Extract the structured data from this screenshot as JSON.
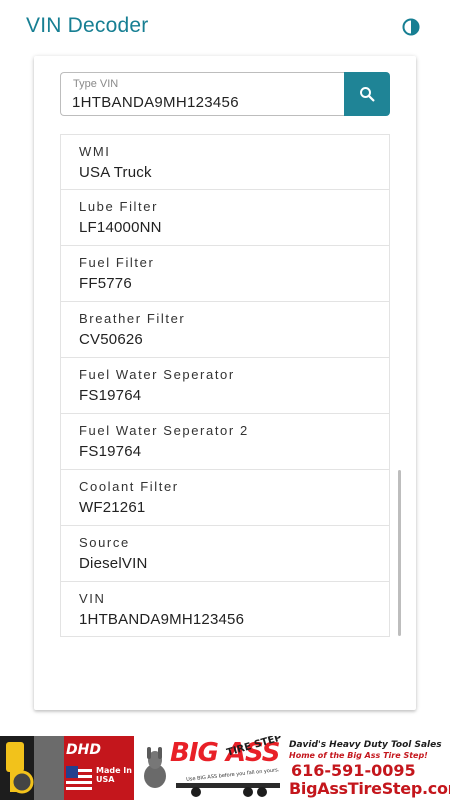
{
  "app": {
    "title": "VIN Decoder",
    "accent_color": "#177f93",
    "theme_toggle_icon": "contrast-icon"
  },
  "search": {
    "label": "Type VIN",
    "value": "1HTBANDA9MH123456",
    "button_icon": "search-icon",
    "button_color": "#1f8496"
  },
  "results": [
    {
      "label": "WMI",
      "value": "USA Truck"
    },
    {
      "label": "Lube Filter",
      "value": "LF14000NN"
    },
    {
      "label": "Fuel Filter",
      "value": "FF5776"
    },
    {
      "label": "Breather Filter",
      "value": "CV50626"
    },
    {
      "label": "Fuel Water Seperator",
      "value": "FS19764"
    },
    {
      "label": "Fuel Water Seperator 2",
      "value": "FS19764"
    },
    {
      "label": "Coolant Filter",
      "value": "WF21261"
    },
    {
      "label": "Source",
      "value": "DieselVIN"
    },
    {
      "label": "VIN",
      "value": "1HTBANDA9MH123456"
    }
  ],
  "ad": {
    "dhd_logo": "DHD",
    "made_in": "Made In USA",
    "brand": "BIG ASS",
    "brand_sub": "TIRE STEP",
    "tagline": "Use BIG ASS before you fall on yours.",
    "line1": "David's Heavy Duty Tool Sales",
    "line2": "Home of the Big Ass Tire Step!",
    "phone": "616-591-0095",
    "url": "BigAssTireStep.com"
  }
}
